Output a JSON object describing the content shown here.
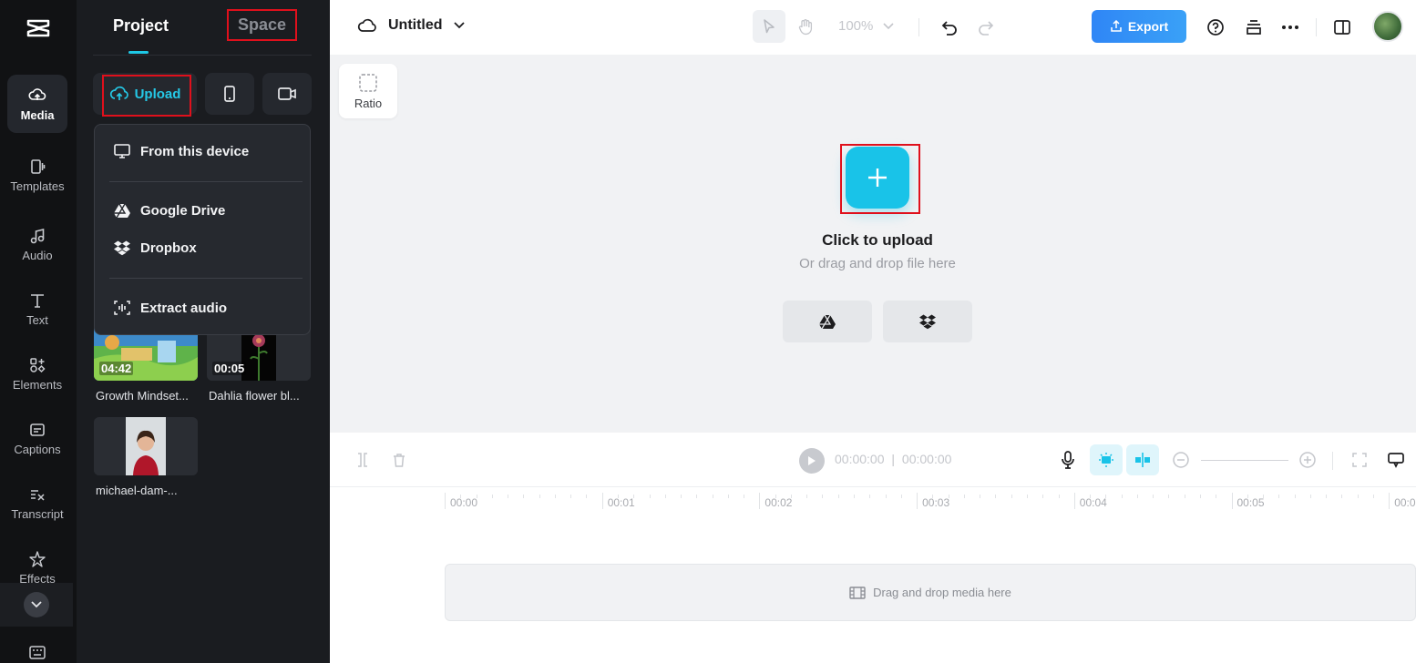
{
  "rail": {
    "items": [
      {
        "label": "Media",
        "icon": "cloud-upload-icon"
      },
      {
        "label": "Templates",
        "icon": "templates-icon"
      },
      {
        "label": "Audio",
        "icon": "music-note-icon"
      },
      {
        "label": "Text",
        "icon": "text-icon"
      },
      {
        "label": "Elements",
        "icon": "elements-icon"
      },
      {
        "label": "Captions",
        "icon": "captions-icon"
      },
      {
        "label": "Transcript",
        "icon": "transcript-icon"
      },
      {
        "label": "Effects",
        "icon": "effects-icon"
      }
    ]
  },
  "panel": {
    "tabs": {
      "project": "Project",
      "space": "Space"
    },
    "upload_label": "Upload",
    "dropdown": {
      "from_device": "From this device",
      "google_drive": "Google Drive",
      "dropbox": "Dropbox",
      "extract_audio": "Extract audio"
    },
    "media": [
      {
        "name": "Growth Mindset...",
        "duration": "04:42"
      },
      {
        "name": "Dahlia flower bl...",
        "duration": "00:05"
      },
      {
        "name": "michael-dam-...",
        "duration": ""
      }
    ]
  },
  "topbar": {
    "title": "Untitled",
    "zoom": "100%",
    "export_label": "Export"
  },
  "canvas": {
    "ratio_label": "Ratio",
    "click_to_upload": "Click to upload",
    "drag_hint": "Or drag and drop file here"
  },
  "timeline": {
    "current_time": "00:00:00",
    "separator": "|",
    "total_time": "00:00:00",
    "ticks": [
      "00:00",
      "00:01",
      "00:02",
      "00:03",
      "00:04",
      "00:05",
      "00:0"
    ],
    "drop_hint": "Drag and drop media here"
  },
  "colors": {
    "accent": "#19c3e8",
    "export": "#2f86f6",
    "highlight_box": "#e0101c",
    "rail_bg": "#111214",
    "panel_bg": "#1a1c20"
  }
}
